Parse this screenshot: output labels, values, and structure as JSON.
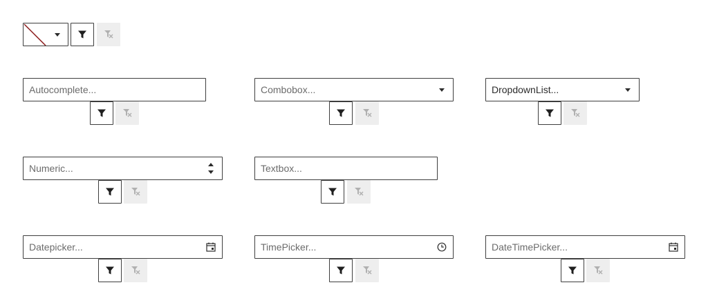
{
  "operator": {
    "value": ""
  },
  "fields": {
    "autocomplete": {
      "placeholder": "Autocomplete..."
    },
    "combobox": {
      "placeholder": "Combobox..."
    },
    "dropdownlist": {
      "value": "DropdownList..."
    },
    "numeric": {
      "placeholder": "Numeric..."
    },
    "textbox": {
      "placeholder": "Textbox..."
    },
    "datepicker": {
      "placeholder": "Datepicker..."
    },
    "timepicker": {
      "placeholder": "TimePicker..."
    },
    "datetimepicker": {
      "placeholder": "DateTimePicker..."
    }
  },
  "icons": {
    "filter": "filter-icon",
    "clear_filter": "filter-clear-icon",
    "dropdown": "caret-down-icon",
    "calendar": "calendar-icon",
    "clock": "clock-icon",
    "spinner": "spinner-arrows-icon"
  },
  "colors": {
    "border": "#3d3d3d",
    "disabled_bg": "#eeeeee",
    "none_indicator": "#8b1a1a"
  }
}
